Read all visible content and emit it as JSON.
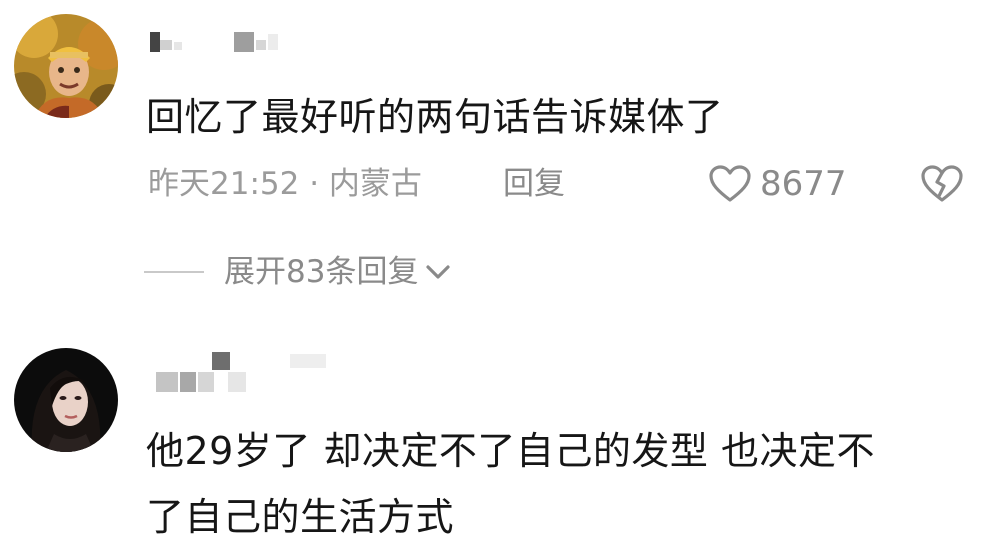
{
  "comments": [
    {
      "username": "",
      "avatar_icon": "monkey-king-avatar",
      "text": "回忆了最好听的两句话告诉媒体了",
      "time_location": "昨天21:52 · 内蒙古",
      "reply_label": "回复",
      "like_count": "8677",
      "expand_label": "展开83条回复"
    },
    {
      "username": "",
      "avatar_icon": "woman-portrait-avatar",
      "text_lines": [
        "他29岁了 却决定不了自己的发型 也决定不",
        "了自己的生活方式"
      ]
    }
  ],
  "icons": {
    "like": "heart-outline-icon",
    "dislike": "broken-heart-icon",
    "expand": "chevron-down-icon"
  },
  "colors": {
    "text": "#161616",
    "meta": "#9b9b9b",
    "action": "#8a8a8a"
  }
}
